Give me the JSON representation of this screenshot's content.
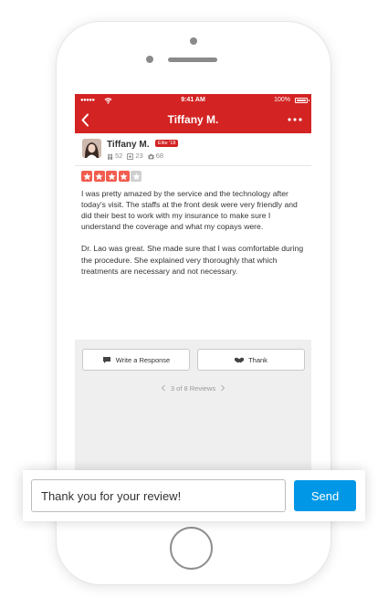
{
  "status_bar": {
    "signal": "●●●●●",
    "time": "9:41 AM",
    "battery": "100%"
  },
  "nav": {
    "title": "Tiffany M."
  },
  "review": {
    "user_name": "Tiffany M.",
    "elite_badge": "Elite '18",
    "stats": {
      "friends": "52",
      "reviews": "23",
      "photos": "68"
    },
    "rating": 4,
    "max_rating": 5,
    "paragraphs": [
      "I was pretty amazed by the service and the technology after today's visit. The staffs at the front desk were very friendly and did their best to work with my insurance to make sure I understand the coverage and what my copays were.",
      "Dr. Lao was great. She made sure that I was comfortable during the procedure. She explained very thoroughly that which treatments are necessary and not necessary."
    ]
  },
  "actions": {
    "write_response": "Write a Response",
    "thank": "Thank"
  },
  "pager": {
    "text": "3 of 8 Reviews"
  },
  "reply": {
    "value": "Thank you for your review!",
    "send_label": "Send"
  },
  "colors": {
    "brand_red": "#d32323",
    "star_red": "#f15c4f",
    "send_blue": "#0098e6"
  },
  "icons": {
    "back": "chevron-left-icon",
    "more": "more-dots-icon",
    "write": "speech-bubble-icon",
    "thank": "handshake-icon"
  }
}
